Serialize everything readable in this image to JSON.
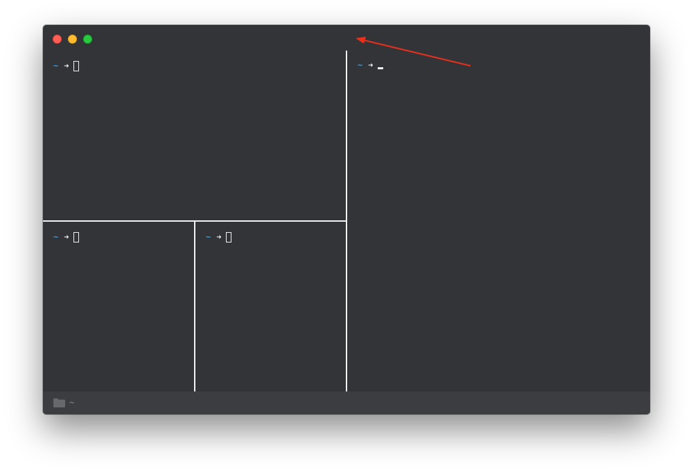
{
  "panes": {
    "top_left": {
      "dir": "~",
      "arrow": "➜"
    },
    "bottom_left": {
      "dir": "~",
      "arrow": "➜"
    },
    "bottom_middle": {
      "dir": "~",
      "arrow": "➜"
    },
    "right": {
      "dir": "~",
      "arrow": "➜"
    }
  },
  "status_bar": {
    "icon": "folder-icon",
    "path": "~"
  },
  "colors": {
    "window_bg": "#333438",
    "status_bg": "#3c3d41",
    "prompt_dir": "#3a9ad9",
    "divider": "#f2f2f2",
    "annotation": "#e8301c",
    "traffic_close": "#fe5f57",
    "traffic_minimize": "#febc2e",
    "traffic_zoom": "#28c840"
  }
}
